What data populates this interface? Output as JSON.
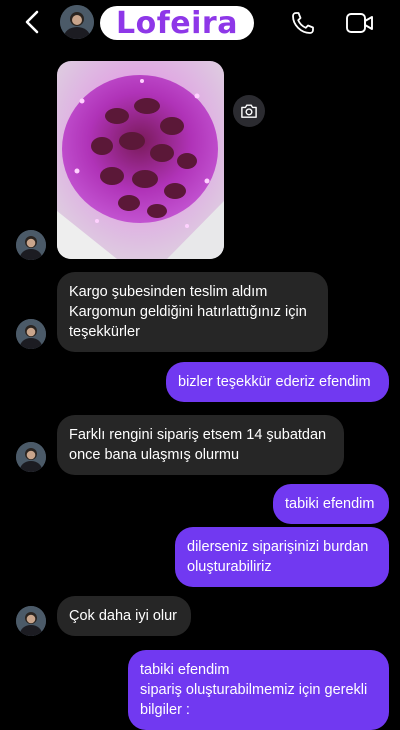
{
  "header": {
    "contact_name": "Lofeira",
    "icons": [
      "back-chevron-icon",
      "phone-icon",
      "video-camera-icon"
    ]
  },
  "colors": {
    "outgoing_bubble": "#7139f1",
    "incoming_bubble": "#262626",
    "name_text": "#8e37e8",
    "background": "#000000"
  },
  "messages": [
    {
      "id": "m1",
      "sender": "contact",
      "type": "image",
      "alt": "photo-attachment"
    },
    {
      "id": "m2",
      "sender": "contact",
      "lines": [
        "Kargo şubesinden teslim aldım",
        "Kargomun geldiğini hatırlattığınız için",
        "teşekkürler"
      ]
    },
    {
      "id": "m3",
      "sender": "me",
      "lines": [
        "bizler teşekkür ederiz efendim"
      ]
    },
    {
      "id": "m4",
      "sender": "contact",
      "lines": [
        "Farklı rengini sipariş etsem 14 şubatdan",
        "once bana ulaşmış olurmu"
      ]
    },
    {
      "id": "m5",
      "sender": "me",
      "lines": [
        "tabiki efendim"
      ]
    },
    {
      "id": "m6",
      "sender": "me",
      "lines": [
        "dilerseniz siparişinizi burdan",
        "oluşturabiliriz"
      ]
    },
    {
      "id": "m7",
      "sender": "contact",
      "lines": [
        "Çok daha iyi olur"
      ]
    },
    {
      "id": "m8",
      "sender": "me",
      "lines": [
        "tabiki efendim",
        "sipariş oluşturabilmemiz için gerekli",
        "bilgiler :"
      ]
    }
  ]
}
